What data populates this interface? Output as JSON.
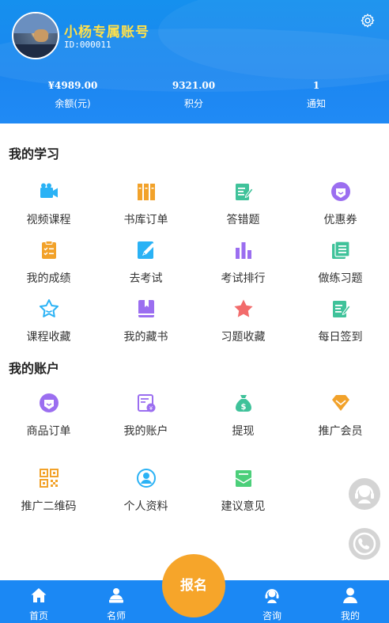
{
  "profile": {
    "name": "小杨专属账号",
    "id_text": "ID:000011"
  },
  "stats": [
    {
      "value": "¥4989.00",
      "label": "余额(元)"
    },
    {
      "value": "9321.00",
      "label": "积分"
    },
    {
      "value": "1",
      "label": "通知"
    }
  ],
  "study": {
    "title": "我的学习",
    "items": [
      {
        "label": "视频课程",
        "icon": "video-camera-icon"
      },
      {
        "label": "书库订单",
        "icon": "books-icon"
      },
      {
        "label": "答错题",
        "icon": "edit-document-icon"
      },
      {
        "label": "优惠券",
        "icon": "coupon-icon"
      },
      {
        "label": "我的成绩",
        "icon": "clipboard-icon"
      },
      {
        "label": "去考试",
        "icon": "pencil-icon"
      },
      {
        "label": "考试排行",
        "icon": "bar-chart-icon"
      },
      {
        "label": "做练习题",
        "icon": "notebook-icon"
      },
      {
        "label": "课程收藏",
        "icon": "star-outline-icon"
      },
      {
        "label": "我的藏书",
        "icon": "bookmark-book-icon"
      },
      {
        "label": "习题收藏",
        "icon": "star-filled-icon"
      },
      {
        "label": "每日签到",
        "icon": "sign-in-icon"
      }
    ]
  },
  "account": {
    "title": "我的账户",
    "items": [
      {
        "label": "商品订单",
        "icon": "order-icon"
      },
      {
        "label": "我的账户",
        "icon": "wallet-icon"
      },
      {
        "label": "提现",
        "icon": "money-bag-icon"
      },
      {
        "label": "推广会员",
        "icon": "diamond-icon"
      },
      {
        "label": "推广二维码",
        "icon": "qr-code-icon"
      },
      {
        "label": "个人资料",
        "icon": "user-circle-icon"
      },
      {
        "label": "建议意见",
        "icon": "feedback-icon"
      }
    ]
  },
  "tabbar": {
    "items": [
      {
        "label": "首页",
        "icon": "home-icon"
      },
      {
        "label": "名师",
        "icon": "teacher-icon"
      },
      {
        "label": "咨询",
        "icon": "headset-icon"
      },
      {
        "label": "我的",
        "icon": "user-icon"
      }
    ],
    "center_label": "报名"
  },
  "colors": {
    "header_blue": "#1590ee",
    "name_yellow": "#ffe04a",
    "center_orange": "#f6a52a"
  }
}
